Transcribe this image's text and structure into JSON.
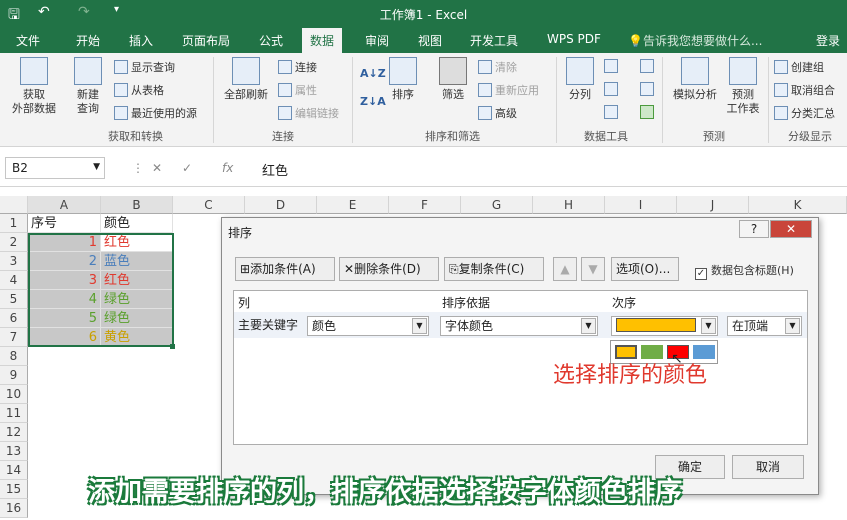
{
  "window": {
    "title": "工作簿1 - Excel"
  },
  "tabs": [
    "文件",
    "开始",
    "插入",
    "页面布局",
    "公式",
    "数据",
    "审阅",
    "视图",
    "开发工具",
    "WPS PDF"
  ],
  "tell_me": "告诉我您想要做什么...",
  "login": "登录",
  "ribbon": {
    "get_external": "获取",
    "get_external2": "外部数据",
    "new_query": "新建",
    "new_query2": "查询",
    "show_queries": "显示查询",
    "from_table": "从表格",
    "recent_sources": "最近使用的源",
    "group_get": "获取和转换",
    "refresh_all": "全部刷新",
    "connections": "连接",
    "properties": "属性",
    "edit_links": "编辑链接",
    "group_conn": "连接",
    "sort": "排序",
    "filter": "筛选",
    "clear": "清除",
    "reapply": "重新应用",
    "advanced": "高级",
    "group_sort": "排序和筛选",
    "split": "分列",
    "group_tools": "数据工具",
    "whatif": "模拟分析",
    "forecast": "预测",
    "forecast2": "工作表",
    "group_forecast": "预测",
    "group": "创建组",
    "ungroup": "取消组合",
    "subtotal": "分类汇总",
    "group_outline": "分级显示"
  },
  "formula_bar": {
    "namebox": "B2",
    "value": "红色"
  },
  "columns": [
    "A",
    "B",
    "C",
    "D",
    "E",
    "F",
    "G",
    "H",
    "I",
    "J",
    "K"
  ],
  "rows": [
    "1",
    "2",
    "3",
    "4",
    "5",
    "6",
    "7",
    "8",
    "9",
    "10",
    "11",
    "12",
    "13",
    "14",
    "15",
    "16"
  ],
  "cells": {
    "a1": "序号",
    "b1": "颜色",
    "a2": "1",
    "b2": "红色",
    "a3": "2",
    "b3": "蓝色",
    "a4": "3",
    "b4": "红色",
    "a5": "4",
    "b5": "绿色",
    "a6": "5",
    "b6": "绿色",
    "a7": "6",
    "b7": "黄色"
  },
  "colors": {
    "red": "#e0392e",
    "blue": "#4a7ebb",
    "green": "#5aa02c",
    "yellow": "#c9a000",
    "swatch_yellow": "#ffc000",
    "swatch_green": "#70ad47",
    "swatch_red": "#ff0000",
    "swatch_blue": "#5b9bd5",
    "excel_green": "#217346"
  },
  "dialog": {
    "title": "排序",
    "help": "?",
    "add": "添加条件(A)",
    "delete": "删除条件(D)",
    "copy": "复制条件(C)",
    "options": "选项(O)...",
    "header_check": "数据包含标题(H)",
    "col_header": "列",
    "sort_on_header": "排序依据",
    "order_header": "次序",
    "primary_key": "主要关键字",
    "column_value": "颜色",
    "sort_on_value": "字体颜色",
    "position_value": "在顶端",
    "ok": "确定",
    "cancel": "取消"
  },
  "annotation": "选择排序的颜色",
  "caption": "添加需要排序的列，排序依据选择按字体颜色排序"
}
